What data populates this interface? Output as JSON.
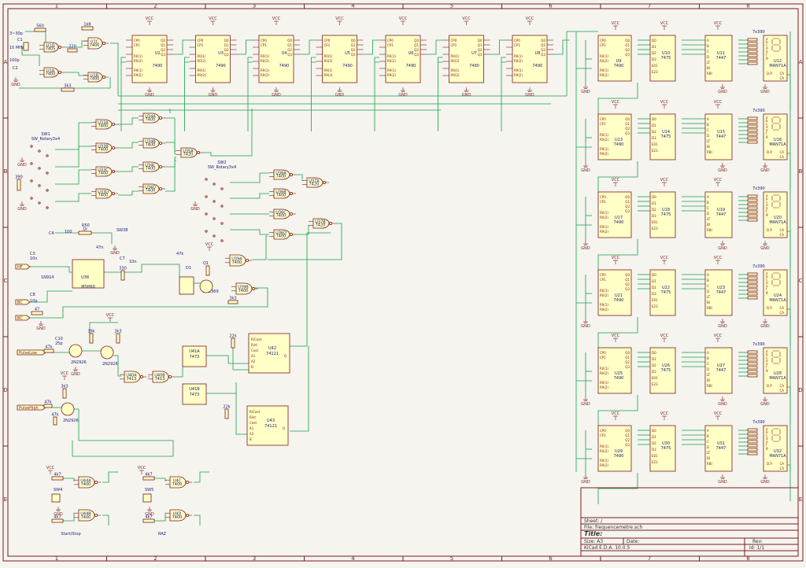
{
  "grid": {
    "columns": [
      "1",
      "2",
      "3",
      "4",
      "5",
      "6",
      "7",
      "8"
    ],
    "rows": [
      "A",
      "B",
      "C",
      "D",
      "E"
    ]
  },
  "counters_top": {
    "chips": [
      {
        "ref": "U2",
        "value": "7490"
      },
      {
        "ref": "U3",
        "value": "7490"
      },
      {
        "ref": "U4",
        "value": "7490"
      },
      {
        "ref": "U5",
        "value": "7490"
      },
      {
        "ref": "U6",
        "value": "7490"
      },
      {
        "ref": "U7",
        "value": "7490"
      },
      {
        "ref": "U8",
        "value": "7490"
      }
    ],
    "pins_left": [
      "CP0",
      "CP1",
      "R0(1)",
      "R0(2)",
      "R9(1)",
      "R9(2)"
    ],
    "pins_right": [
      "Q0",
      "Q1",
      "Q2",
      "Q3"
    ],
    "power": "VCC",
    "ground": "GND"
  },
  "oscillator": {
    "parts": [
      "560",
      "C1",
      "3~30p",
      "10 MHz",
      "100p",
      "U1D",
      "7405",
      "220",
      "1k8",
      "U1C",
      "7400",
      "U1A",
      "7400",
      "U1B",
      "7400",
      "3k3",
      "C2"
    ],
    "ground": "GND"
  },
  "selector_logic": {
    "switch1": {
      "ref": "SW1",
      "value": "SW_Rotary3x4"
    },
    "switch2": {
      "ref": "SW2",
      "value": "SW_Rotary3x4"
    },
    "gates": [
      {
        "ref": "U33A",
        "value": "7400"
      },
      {
        "ref": "U33B",
        "value": "7400"
      },
      {
        "ref": "U33C",
        "value": "7400"
      },
      {
        "ref": "U33D",
        "value": "7400"
      },
      {
        "ref": "U34A",
        "value": "7400"
      },
      {
        "ref": "U34B",
        "value": "7400"
      },
      {
        "ref": "U34C",
        "value": "7400"
      },
      {
        "ref": "U34D",
        "value": "7400"
      },
      {
        "ref": "U35A",
        "value": "7420"
      },
      {
        "ref": "U36A",
        "value": "7400"
      },
      {
        "ref": "U36B",
        "value": "7400"
      },
      {
        "ref": "U36C",
        "value": "7400"
      },
      {
        "ref": "U36D",
        "value": "7400"
      },
      {
        "ref": "U37A",
        "value": "7420"
      },
      {
        "ref": "U37B",
        "value": "7420"
      }
    ],
    "resistor": "390"
  },
  "input_stage": {
    "ports": [
      "HF",
      "BC",
      "BC"
    ],
    "parts": [
      "C3",
      "10n",
      "C4",
      "100",
      "R50",
      "1k",
      "SW38",
      "47n",
      "C7",
      "10n",
      "330",
      "47k",
      "D1",
      "1N914",
      "U38",
      "3k3",
      "47",
      "1N914",
      "1N914",
      "C8",
      "10p",
      "Q1",
      "2N2369"
    ],
    "opamp": {
      "ref": "U38",
      "value": "MSH60"
    },
    "gates": [
      {
        "ref": "U39A",
        "value": "7400"
      },
      {
        "ref": "U39B",
        "value": "7400"
      }
    ],
    "power": "VCC"
  },
  "pulse_stage": {
    "ports": [
      "PulseLow",
      "PulseHigh"
    ],
    "transistors": [
      "2N2926",
      "2N2926",
      "2N2926"
    ],
    "resistors": [
      "47k",
      "39k",
      "3k3",
      "22k",
      "47k",
      "39k",
      "3k3",
      "22k",
      "22k",
      "47k",
      "3k3"
    ],
    "caps": [
      "C10",
      "25p"
    ],
    "flipflops": [
      {
        "ref": "U41A",
        "value": "7473"
      },
      {
        "ref": "U41B",
        "value": "7473"
      }
    ],
    "gates": [
      {
        "ref": "U40A",
        "value": "7413"
      },
      {
        "ref": "U40B",
        "value": "7413"
      }
    ],
    "monostables": [
      {
        "ref": "U42",
        "value": "74121"
      },
      {
        "ref": "U43",
        "value": "74121"
      }
    ],
    "mono_pins": [
      "R/Cext",
      "Rint",
      "Cext",
      "A1",
      "A2",
      "B",
      "Q"
    ]
  },
  "control": {
    "start_stop": {
      "switch": "SW4",
      "gates": [
        {
          "ref": "U44A",
          "value": "7400"
        },
        {
          "ref": "U44B",
          "value": "7400"
        }
      ],
      "resistors": [
        "4k7",
        "4k7"
      ],
      "label": "Start/Stop"
    },
    "raz": {
      "switch": "SW5",
      "gates": [
        {
          "ref": "U4C",
          "value": "7400"
        },
        {
          "ref": "U4D",
          "value": "7400"
        }
      ],
      "resistors": [
        "4k7",
        "4k7"
      ],
      "label": "RAZ"
    }
  },
  "display_chain": {
    "rows": [
      {
        "counter": "U9",
        "latch": "U10",
        "decoder": "U11",
        "display": "U12"
      },
      {
        "counter": "U13",
        "latch": "U14",
        "decoder": "U15",
        "display": "U16"
      },
      {
        "counter": "U17",
        "latch": "U18",
        "decoder": "U19",
        "display": "U20"
      },
      {
        "counter": "U21",
        "latch": "U22",
        "decoder": "U23",
        "display": "U24"
      },
      {
        "counter": "U25",
        "latch": "U26",
        "decoder": "U27",
        "display": "U28"
      },
      {
        "counter": "U29",
        "latch": "U30",
        "decoder": "U31",
        "display": "U32"
      }
    ],
    "counter_value": "7490",
    "latch_value": "7475",
    "decoder_value": "7447",
    "display_value": "MAN71A",
    "resistor_array": "7x390",
    "latch_pins": [
      "D0",
      "D1",
      "D2",
      "D3",
      "E01",
      "E23"
    ],
    "decoder_pins": [
      "A",
      "B",
      "C",
      "D",
      "LT",
      "BI",
      "RBI"
    ],
    "display_pins": [
      "a",
      "b",
      "c",
      "d",
      "e",
      "f",
      "g",
      "D.P.",
      "CA",
      "CA"
    ],
    "power": "VCC",
    "ground": "GND"
  },
  "title_block": {
    "sheet": "Sheet: /",
    "file": "File: frequencemetre.sch",
    "title": "Title:",
    "size": "Size: A3",
    "date": "Date:",
    "kicad": "KiCad E.D.A.  10.0.5",
    "rev": "Rev:",
    "id": "Id: 1/1"
  }
}
